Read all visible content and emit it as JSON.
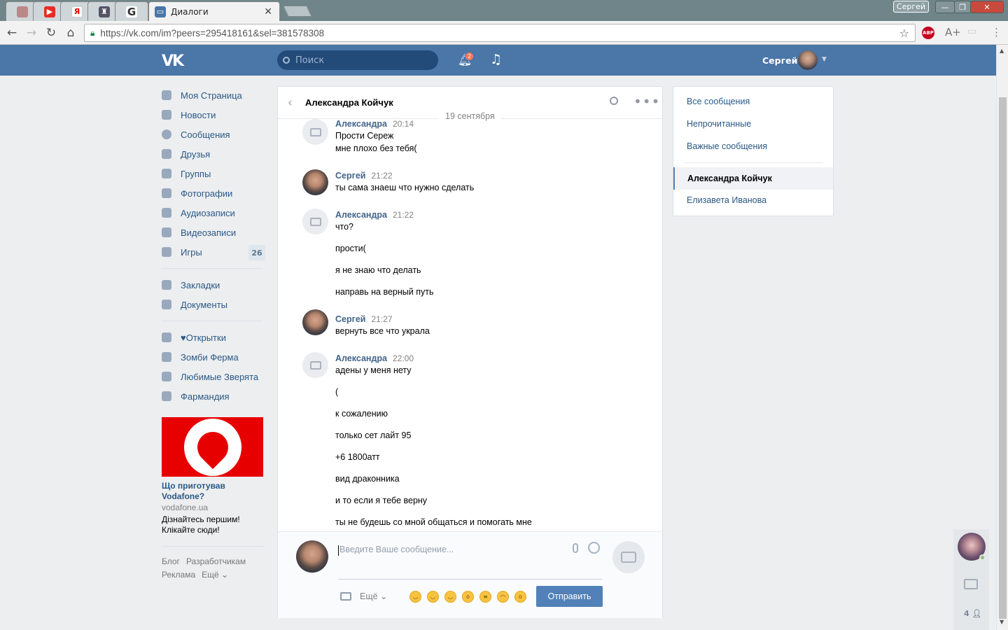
{
  "browser": {
    "active_tab_title": "Диалоги",
    "url": "https://vk.com/im?peers=295418161&sel=381578308",
    "profile_chip": "Сергей"
  },
  "header": {
    "search_placeholder": "Поиск",
    "notifications_count": "2",
    "user_name": "Сергей"
  },
  "sidebar": {
    "items": [
      {
        "label": "Моя Страница"
      },
      {
        "label": "Новости"
      },
      {
        "label": "Сообщения"
      },
      {
        "label": "Друзья"
      },
      {
        "label": "Группы"
      },
      {
        "label": "Фотографии"
      },
      {
        "label": "Аудиозаписи"
      },
      {
        "label": "Видеозаписи"
      },
      {
        "label": "Игры",
        "count": "26"
      }
    ],
    "items2": [
      {
        "label": "Закладки"
      },
      {
        "label": "Документы"
      }
    ],
    "apps": [
      {
        "label": "♥Открытки"
      },
      {
        "label": "Зомби Ферма"
      },
      {
        "label": "Любимые Зверята"
      },
      {
        "label": "Фармандия"
      }
    ]
  },
  "ad": {
    "title": "Що приготував Vodafone?",
    "domain": "vodafone.ua",
    "text": "Дізнайтесь першим! Клікайте сюди!"
  },
  "footer": {
    "links": [
      "Блог",
      "Разработчикам",
      "Реклама",
      "Ещё ⌄"
    ]
  },
  "dialog": {
    "title": "Александра Койчук",
    "date": "19 сентября",
    "messages": [
      {
        "author": "Александра",
        "time": "20:14",
        "lines": [
          "Прости Сереж",
          "мне плохо без тебя("
        ]
      },
      {
        "author": "Сергей",
        "time": "21:22",
        "lines": [
          "ты сама знаеш что нужно сделать"
        ]
      },
      {
        "author": "Александра",
        "time": "21:22",
        "lines": [
          "что?",
          "прости(",
          "я не знаю что делать",
          "направь на верный путь"
        ]
      },
      {
        "author": "Сергей",
        "time": "21:27",
        "lines": [
          "вернуть все что украла"
        ]
      },
      {
        "author": "Александра",
        "time": "22:00",
        "lines": [
          "адены у меня нету",
          "(",
          "к сожалению",
          "только сет лайт 95",
          "+6 1800атт",
          "вид драконника",
          "и то если я тебе верну",
          "ты не будешь со мной общаться и помогать мне"
        ]
      }
    ],
    "input_placeholder": "Введите Ваше сообщение...",
    "more_label": "Ещё ⌄",
    "send_label": "Отправить"
  },
  "right_panel": {
    "filters": [
      "Все сообщения",
      "Непрочитанные",
      "Важные сообщения"
    ],
    "selected": "Александра Койчук",
    "other": "Елизавета Иванова"
  },
  "chat_bar": {
    "count": "4"
  }
}
